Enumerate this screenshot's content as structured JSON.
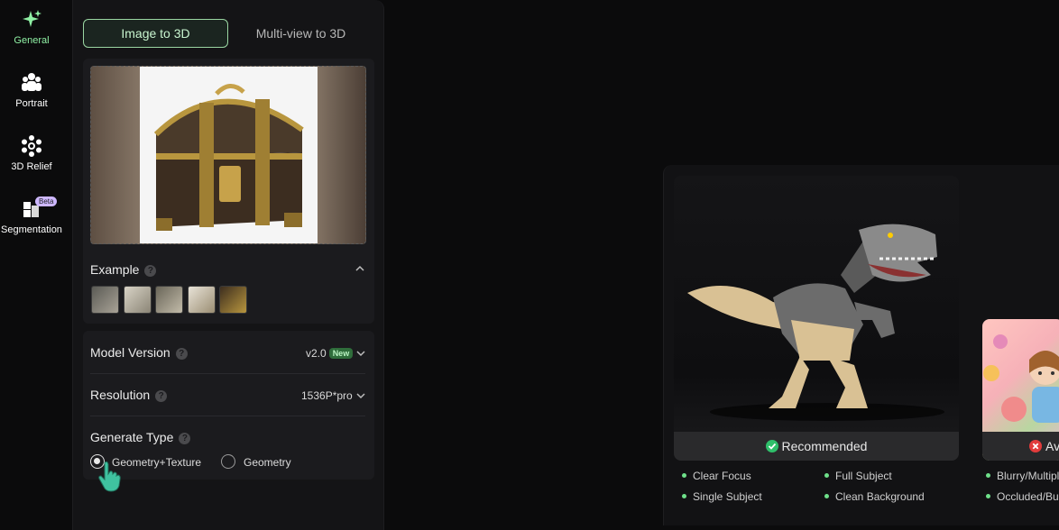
{
  "nav": {
    "items": [
      {
        "label": "General",
        "icon": "sparkle-icon",
        "active": true
      },
      {
        "label": "Portrait",
        "icon": "people-icon",
        "active": false
      },
      {
        "label": "3D Relief",
        "icon": "gear-icon",
        "active": false
      },
      {
        "label": "Segmentation",
        "icon": "segmentation-icon",
        "active": false
      }
    ],
    "beta_badge": "Beta"
  },
  "tabs": {
    "image_to_3d": "Image to 3D",
    "multiview_to_3d": "Multi-view to 3D"
  },
  "example": {
    "label": "Example",
    "help": "?"
  },
  "model_version": {
    "label": "Model Version",
    "help": "?",
    "value": "v2.0",
    "badge": "New"
  },
  "resolution": {
    "label": "Resolution",
    "help": "?",
    "value": "1536P*pro"
  },
  "generate_type": {
    "label": "Generate Type",
    "help": "?",
    "options": [
      "Geometry+Texture",
      "Geometry"
    ],
    "selected": "Geometry+Texture"
  },
  "showcase": {
    "recommended_label": "Recommended",
    "recommended_points": [
      "Clear Focus",
      "Full Subject",
      "Single Subject",
      "Clean Background"
    ],
    "avoid_label": "Av",
    "avoid_points": [
      "Blurry/Multipl",
      "Occluded/Bus"
    ]
  },
  "colors": {
    "accent": "#8ff0a4",
    "recommended": "#2fbf6a",
    "avoid": "#e23b3b"
  }
}
